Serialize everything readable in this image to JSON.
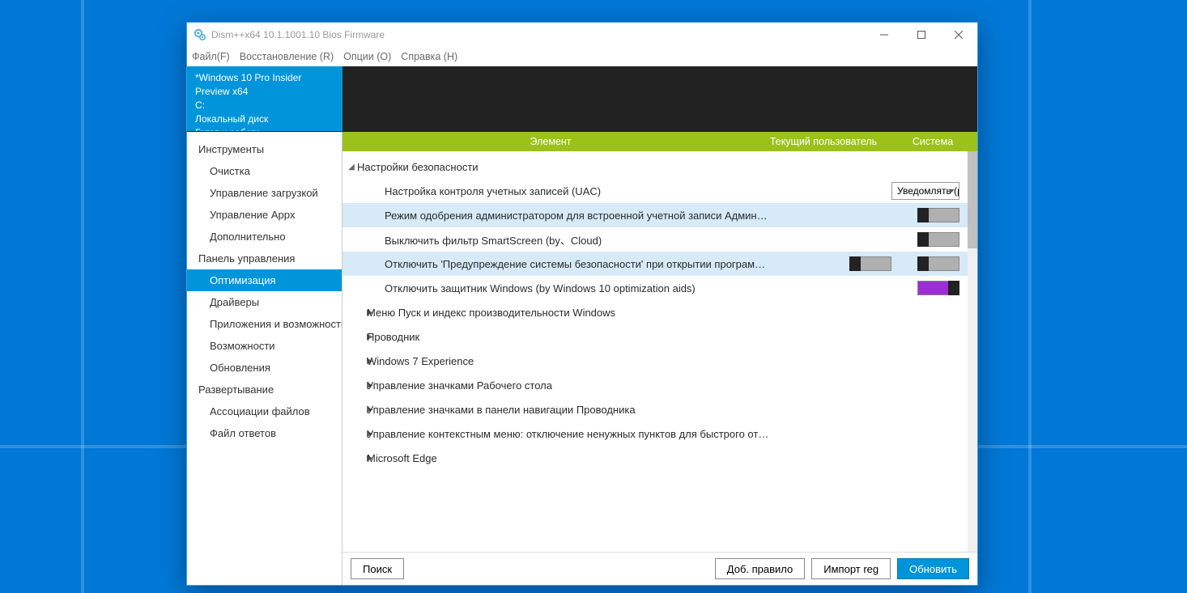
{
  "window": {
    "title": "Dism++x64 10.1.1001.10 Bios Firmware"
  },
  "menu": {
    "file": "Файл(F)",
    "restore": "Восстановление (R)",
    "options": "Опции (O)",
    "help": "Справка (H)"
  },
  "info": {
    "line1": "*Windows 10 Pro Insider Preview x64",
    "line2": "C:",
    "line3": "Локальный диск",
    "line4": "Готов к работе"
  },
  "sidebar": {
    "groups": [
      {
        "title": "Инструменты",
        "items": [
          "Очистка",
          "Управление загрузкой",
          "Управление Appx",
          "Дополнительно"
        ]
      },
      {
        "title": "Панель управления",
        "items": [
          "Оптимизация",
          "Драйверы",
          "Приложения и возможности",
          "Возможности",
          "Обновления"
        ]
      },
      {
        "title": "Развертывание",
        "items": [
          "Ассоциации файлов",
          "Файл ответов"
        ]
      }
    ],
    "active": "Оптимизация"
  },
  "columns": {
    "c1": "Элемент",
    "c2": "Текущий пользователь",
    "c3": "Система"
  },
  "tree": {
    "securityTitle": "Настройки безопасности",
    "rows": [
      {
        "label": "Настройка контроля учетных записей (UAC)",
        "control": "dropdown",
        "value": "Уведомлять (реком",
        "highlight": false
      },
      {
        "label": "Режим одобрения администратором для встроенной учетной записи Администрат",
        "control": "toggle",
        "highlight": true
      },
      {
        "label": "Выключить фильтр SmartScreen (by、Cloud)",
        "control": "toggle",
        "highlight": false
      },
      {
        "label": "Отключить 'Предупреждение системы безопасности' при открытии программ (by M",
        "control": "toggle2",
        "highlight": true
      },
      {
        "label": "Отключить защитник Windows (by Windows 10 optimization aids)",
        "control": "toggle-purple",
        "highlight": false
      }
    ],
    "collapsed": [
      "Меню Пуск и индекс производительности Windows",
      "Проводник",
      "Windows 7 Experience",
      "Управление значками Рабочего стола",
      "Управление значками в панели навигации Проводника",
      "Управление контекстным меню: отключение ненужных пунктов для быстрого отклика Проводника",
      "Microsoft Edge"
    ]
  },
  "buttons": {
    "search": "Поиск",
    "addrule": "Доб. правило",
    "importreg": "Импорт reg",
    "refresh": "Обновить"
  }
}
